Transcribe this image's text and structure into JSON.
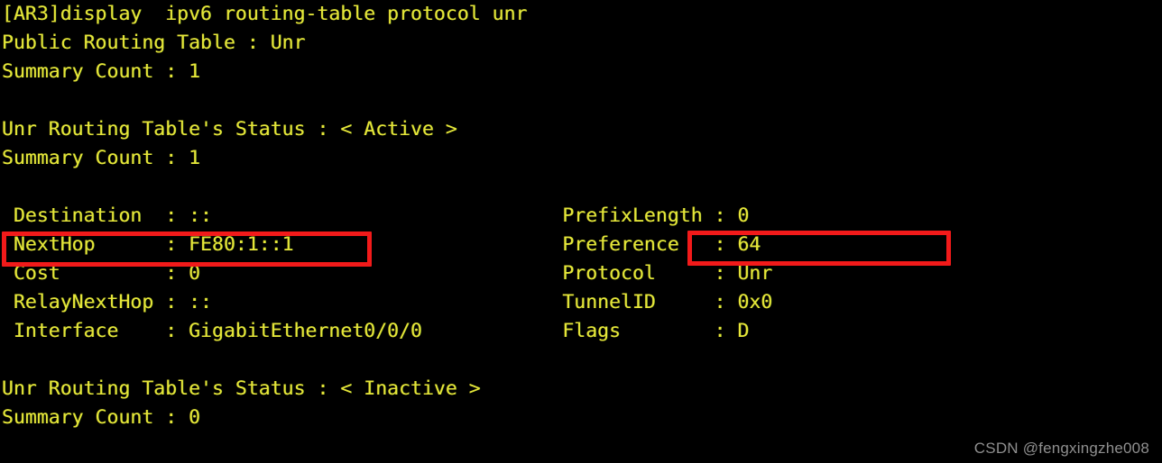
{
  "terminal": {
    "prompt_line": "[AR3]display  ipv6 routing-table protocol unr",
    "screen_text": "[AR3]display  ipv6 routing-table protocol unr\nPublic Routing Table : Unr\nSummary Count : 1\n\nUnr Routing Table's Status : < Active >\nSummary Count : 1\n\n Destination  : ::                              PrefixLength : 0\n NextHop      : FE80:1::1                       Preference   : 64\n Cost         : 0                               Protocol     : Unr\n RelayNextHop : ::                              TunnelID     : 0x0\n Interface    : GigabitEthernet0/0/0            Flags        : D\n\nUnr Routing Table's Status : < Inactive >\nSummary Count : 0",
    "lines": [
      "[AR3]display  ipv6 routing-table protocol unr",
      "Public Routing Table : Unr",
      "Summary Count : 1",
      "",
      "Unr Routing Table's Status : < Active >",
      "Summary Count : 1",
      "",
      " Destination  : ::                              PrefixLength : 0",
      " NextHop      : FE80:1::1                       Preference   : 64",
      " Cost         : 0                               Protocol     : Unr",
      " RelayNextHop : ::                              TunnelID     : 0x0",
      " Interface    : GigabitEthernet0/0/0            Flags        : D",
      "",
      "Unr Routing Table's Status : < Inactive >",
      "Summary Count : 0"
    ],
    "header": {
      "public_routing_table_label": "Public Routing Table",
      "public_routing_table_value": "Unr",
      "summary_count_label": "Summary Count",
      "summary_count_value": "1"
    },
    "active_table": {
      "status_label": "Unr Routing Table's Status",
      "status_value": "< Active >",
      "summary_count_label": "Summary Count",
      "summary_count_value": "1"
    },
    "route_entry": {
      "destination_label": "Destination",
      "destination_value": "::",
      "prefixlength_label": "PrefixLength",
      "prefixlength_value": "0",
      "nexthop_label": "NextHop",
      "nexthop_value": "FE80:1::1",
      "preference_label": "Preference",
      "preference_value": "64",
      "cost_label": "Cost",
      "cost_value": "0",
      "protocol_label": "Protocol",
      "protocol_value": "Unr",
      "relaynexthop_label": "RelayNextHop",
      "relaynexthop_value": "::",
      "tunnelid_label": "TunnelID",
      "tunnelid_value": "0x0",
      "interface_label": "Interface",
      "interface_value": "GigabitEthernet0/0/0",
      "flags_label": "Flags",
      "flags_value": "D"
    },
    "inactive_table": {
      "status_label": "Unr Routing Table's Status",
      "status_value": "< Inactive >",
      "summary_count_label": "Summary Count",
      "summary_count_value": "0"
    }
  },
  "highlights": [
    {
      "target": "nexthop-row",
      "color": "#f21a1a"
    },
    {
      "target": "preference-row",
      "color": "#f21a1a"
    }
  ],
  "watermark": {
    "text": "CSDN @fengxingzhe008"
  },
  "colors": {
    "background": "#000000",
    "text": "#e6e63a",
    "highlight": "#f21a1a",
    "watermark": "#8f8f8f"
  }
}
